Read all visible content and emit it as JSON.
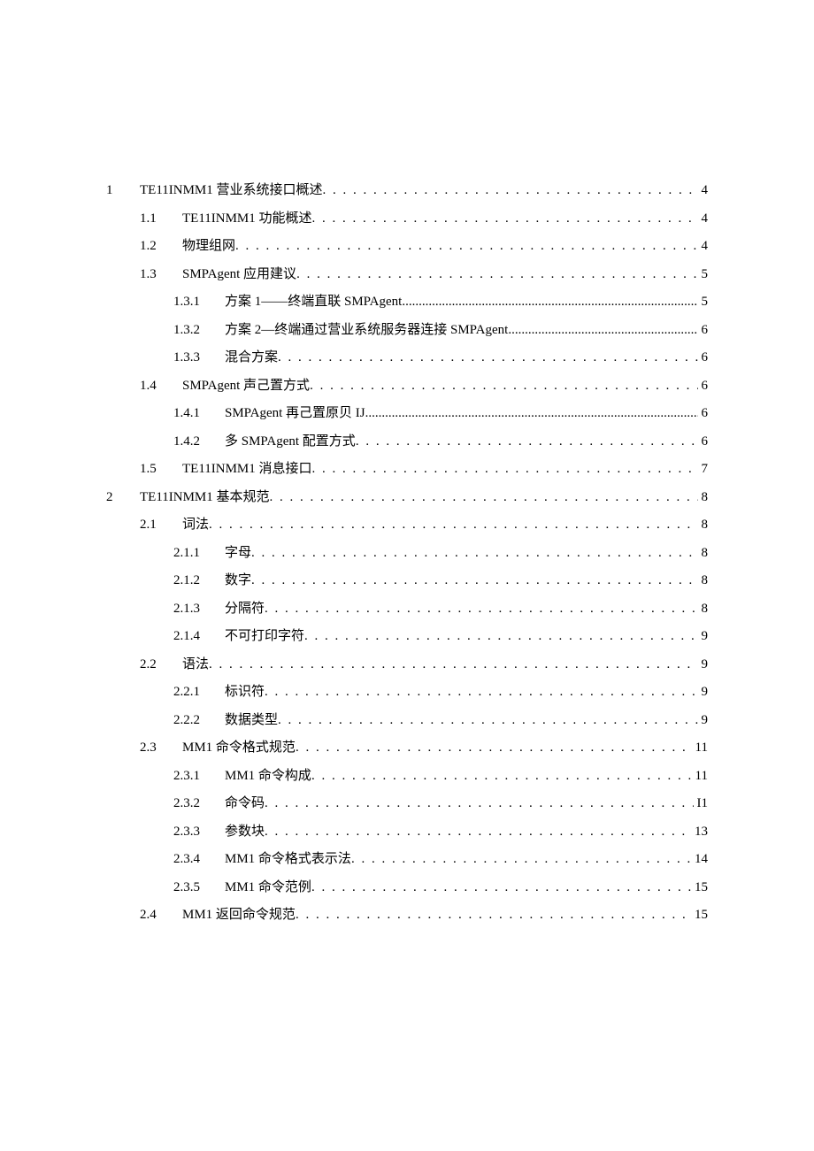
{
  "toc": [
    {
      "level": 1,
      "num": "1",
      "title": "TE11INMM1 营业系统接口概述",
      "page": "4",
      "leader": "dots"
    },
    {
      "level": 2,
      "num": "1.1",
      "title": "TE11INMM1 功能概述",
      "page": "4",
      "leader": "dots"
    },
    {
      "level": 2,
      "num": "1.2",
      "title": "物理组网",
      "page": "4",
      "leader": "dots"
    },
    {
      "level": 2,
      "num": "1.3",
      "title": "SMPAgent 应用建议",
      "page": "5",
      "leader": "dots"
    },
    {
      "level": 3,
      "num": "1.3.1",
      "title": "方案 1——终端直联 SMPAgent",
      "page": "5",
      "leader": "tight"
    },
    {
      "level": 3,
      "num": "1.3.2",
      "title": "方案 2—终端通过营业系统服务器连接 SMPAgent",
      "page": "6",
      "leader": "tight"
    },
    {
      "level": 3,
      "num": "1.3.3",
      "title": "混合方案",
      "page": "6",
      "leader": "dots"
    },
    {
      "level": 2,
      "num": "1.4",
      "title": "SMPAgent 声己置方式",
      "page": "6",
      "leader": "dots"
    },
    {
      "level": 3,
      "num": "1.4.1",
      "title": "SMPAgent 再己置原贝 IJ",
      "page": "6",
      "leader": "tight"
    },
    {
      "level": 3,
      "num": "1.4.2",
      "title": "多 SMPAgent 配置方式",
      "page": "6",
      "leader": "dots"
    },
    {
      "level": 2,
      "num": "1.5",
      "title": "TE11INMM1 消息接口",
      "page": "7",
      "leader": "dots"
    },
    {
      "level": 1,
      "num": "2",
      "title": "TE11INMM1 基本规范",
      "page": "8",
      "leader": "dots"
    },
    {
      "level": 2,
      "num": "2.1",
      "title": "词法",
      "page": "8",
      "leader": "dots"
    },
    {
      "level": 3,
      "num": "2.1.1",
      "title": "字母",
      "page": "8",
      "leader": "dots"
    },
    {
      "level": 3,
      "num": "2.1.2",
      "title": "数字",
      "page": "8",
      "leader": "dots"
    },
    {
      "level": 3,
      "num": "2.1.3",
      "title": "分隔符",
      "page": "8",
      "leader": "dots"
    },
    {
      "level": 3,
      "num": "2.1.4",
      "title": "不可打印字符",
      "page": "9",
      "leader": "dots"
    },
    {
      "level": 2,
      "num": "2.2",
      "title": "语法",
      "page": "9",
      "leader": "dots"
    },
    {
      "level": 3,
      "num": "2.2.1",
      "title": "标识符",
      "page": "9",
      "leader": "dots"
    },
    {
      "level": 3,
      "num": "2.2.2",
      "title": "数据类型",
      "page": "9",
      "leader": "dots"
    },
    {
      "level": 2,
      "num": "2.3",
      "title": "MM1 命令格式规范",
      "page": "11",
      "leader": "dots"
    },
    {
      "level": 3,
      "num": "2.3.1",
      "title": "MM1 命令构成",
      "page": "11",
      "leader": "dots"
    },
    {
      "level": 3,
      "num": "2.3.2",
      "title": "命令码",
      "page": "I1",
      "leader": "dots"
    },
    {
      "level": 3,
      "num": "2.3.3",
      "title": "参数块",
      "page": "13",
      "leader": "dots"
    },
    {
      "level": 3,
      "num": "2.3.4",
      "title": "MM1 命令格式表示法",
      "page": "14",
      "leader": "dots"
    },
    {
      "level": 3,
      "num": "2.3.5",
      "title": "MM1 命令范例",
      "page": "15",
      "leader": "dots"
    },
    {
      "level": 2,
      "num": "2.4",
      "title": "MM1 返回命令规范",
      "page": "15",
      "leader": "dots"
    }
  ]
}
